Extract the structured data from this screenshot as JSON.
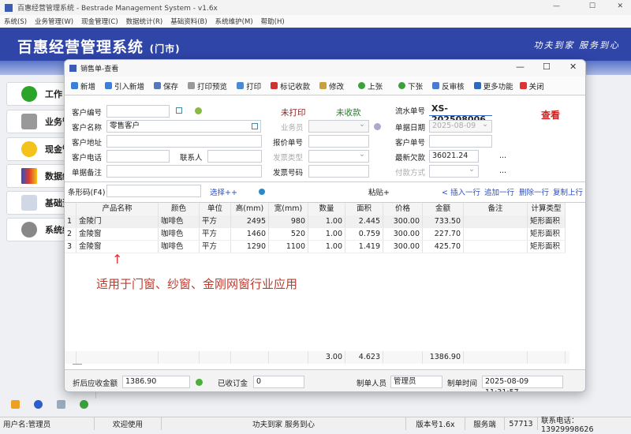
{
  "window": {
    "title": "百惠经营管理系统 - Bestrade Management System - v1.6x"
  },
  "menu": [
    "系统(S)",
    "业务管理(W)",
    "现金管理(C)",
    "数据统计(R)",
    "基础资料(B)",
    "系统维护(M)",
    "帮助(H)"
  ],
  "banner": {
    "title": "百惠经营管理系统",
    "subtitle": "(门市)",
    "slogan": "功夫到家 服务到心"
  },
  "nav": [
    "工作",
    "业务管",
    "现金管",
    "数据统",
    "基础资",
    "系统维"
  ],
  "dialog": {
    "title": "销售单-查看",
    "toolbar": [
      "新增",
      "引入新增",
      "保存",
      "打印预览",
      "打印",
      "标记收款",
      "修改",
      "上张",
      "下张",
      "反审核",
      "更多功能",
      "关闭"
    ],
    "form": {
      "customer_no_label": "客户编号",
      "customer_no": "",
      "print_status": "未打印",
      "pay_status": "未收款",
      "serial_label": "流水单号",
      "serial": "XS-202508006",
      "mode": "查看",
      "customer_name_label": "客户名称",
      "customer_name": "零售客户",
      "salesman_label": "业务员",
      "date_label": "单据日期",
      "date": "2025-08-09",
      "address_label": "客户地址",
      "quote_label": "报价单号",
      "cust_order_label": "客户单号",
      "phone_label": "客户电话",
      "contact_label": "联系人",
      "invoice_type_label": "发票类型",
      "debt_label": "最新欠款",
      "debt": "36021.24",
      "remark_label": "单据备注",
      "invoice_no_label": "发票号码",
      "pay_method_label": "付款方式",
      "more": "..."
    },
    "barcode": {
      "label": "条形码(F4)",
      "select": "选择++",
      "paste": "粘贴+",
      "insert": "< 插入一行",
      "append": "追加一行",
      "delete": "删除一行",
      "copy": "复制上行"
    },
    "columns": [
      "",
      "产品名称",
      "颜色",
      "单位",
      "高(mm)",
      "宽(mm)",
      "数量",
      "面积",
      "价格",
      "金额",
      "备注",
      "计算类型"
    ],
    "rows": [
      [
        "1",
        "金陵门",
        "咖啡色",
        "平方",
        "2495",
        "980",
        "1.00",
        "2.445",
        "300.00",
        "733.50",
        "",
        "矩形面积"
      ],
      [
        "2",
        "金陵窗",
        "咖啡色",
        "平方",
        "1460",
        "520",
        "1.00",
        "0.759",
        "300.00",
        "227.70",
        "",
        "矩形面积"
      ],
      [
        "3",
        "金陵窗",
        "咖啡色",
        "平方",
        "1290",
        "1100",
        "1.00",
        "1.419",
        "300.00",
        "425.70",
        "",
        "矩形面积"
      ]
    ],
    "totals": {
      "qty": "3.00",
      "area": "4.623",
      "amount": "1386.90"
    },
    "annotation": "适用于门窗、纱窗、金刚网窗行业应用",
    "footer": {
      "net_label": "折后应收金额",
      "net": "1386.90",
      "deposit_label": "已收订金",
      "deposit": "0",
      "maker_label": "制单人员",
      "maker": "管理员",
      "time_label": "制单时间",
      "time": "2025-08-09 11:31:57"
    }
  },
  "status": [
    "用户名:管理员",
    "欢迎使用",
    "功夫到家 服务到心",
    "版本号1.6x",
    "服务端",
    "57713",
    "联系电话：13929998626"
  ]
}
